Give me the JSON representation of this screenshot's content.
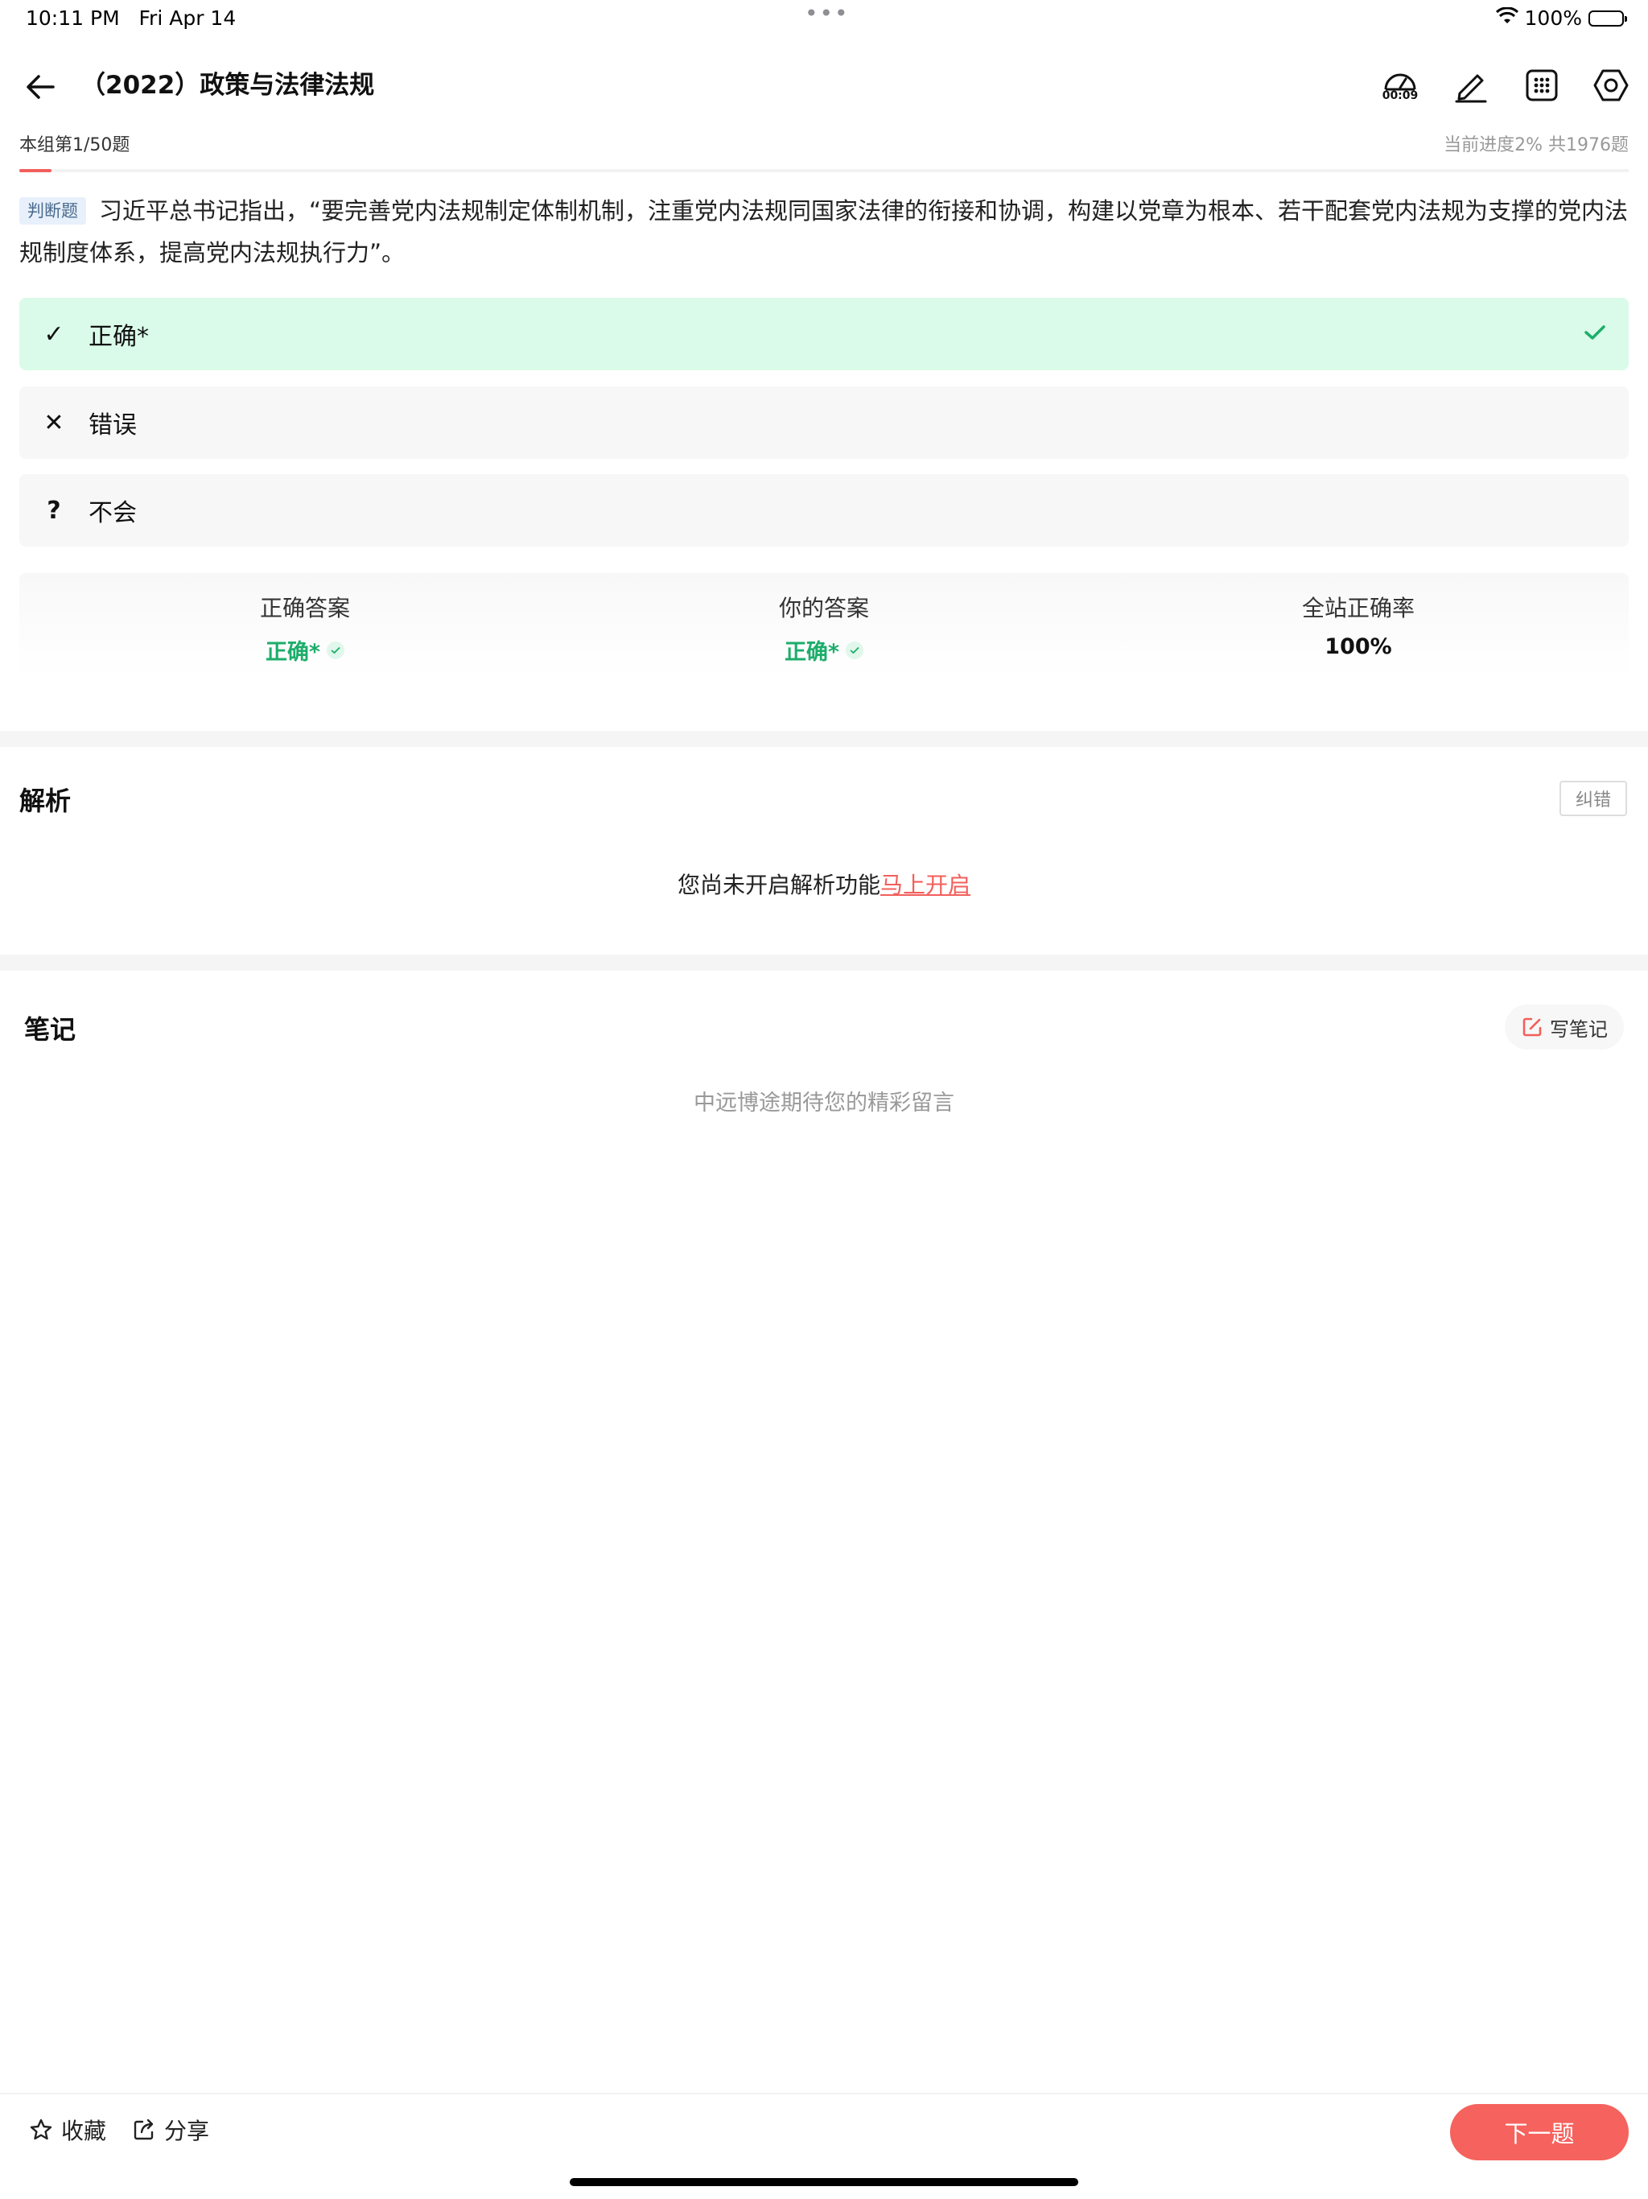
{
  "status_bar": {
    "time": "10:11 PM",
    "date": "Fri Apr 14",
    "dots": "•••",
    "battery": "100%"
  },
  "header": {
    "title": "（2022）政策与法律法规",
    "timer": "00:09"
  },
  "progress": {
    "group_label": "本组第1/50题",
    "progress_text": "当前进度2%  共1976题",
    "fraction": 0.02
  },
  "question": {
    "type_badge": "判断题",
    "text": "习近平总书记指出，“要完善党内法规制定体制机制，注重党内法规同国家法律的衔接和协调，构建以党章为根本、若干配套党内法规为支撑的党内法规制度体系，提高党内法规执行力”。"
  },
  "options": [
    {
      "mark": "✓",
      "label": "正确*",
      "selected": true
    },
    {
      "mark": "✕",
      "label": "错误",
      "selected": false
    },
    {
      "mark": "?",
      "label": "不会",
      "selected": false
    }
  ],
  "summary": {
    "correct_answer_label": "正确答案",
    "correct_answer_value": "正确*",
    "your_answer_label": "你的答案",
    "your_answer_value": "正确*",
    "site_rate_label": "全站正确率",
    "site_rate_value": "100%"
  },
  "analysis": {
    "title": "解析",
    "report_label": "纠错",
    "message": "您尚未开启解析功能",
    "link": "马上开启"
  },
  "notes": {
    "title": "笔记",
    "write_label": "写笔记",
    "empty": "中远博途期待您的精彩留言"
  },
  "bottom": {
    "favorite": "收藏",
    "share": "分享",
    "next": "下一题"
  },
  "colors": {
    "accent": "#f25f5c",
    "success": "#1dad6b",
    "selected_bg": "#dafbe9"
  }
}
